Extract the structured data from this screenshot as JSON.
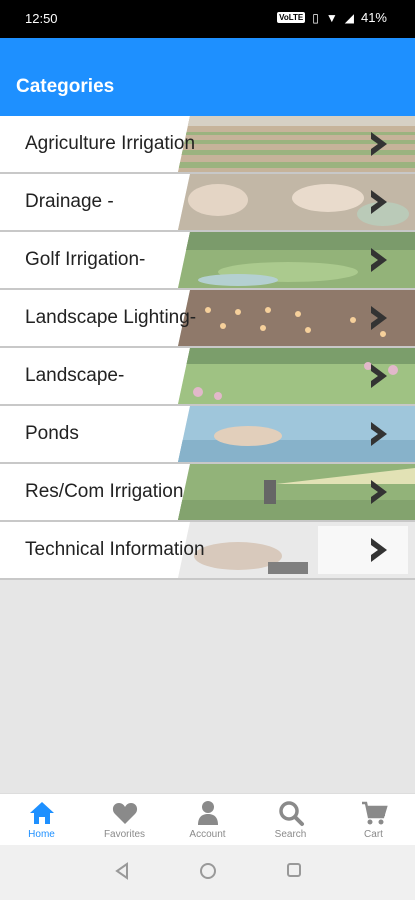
{
  "status_bar": {
    "time": "12:50",
    "volte": "VoLTE",
    "battery": "41%"
  },
  "app_bar": {
    "title": "Categories"
  },
  "categories": [
    {
      "label": "Agriculture Irrigation",
      "image": "crop-field"
    },
    {
      "label": "Drainage -",
      "image": "hands-soil"
    },
    {
      "label": "Golf Irrigation-",
      "image": "golf-course-sprinkler"
    },
    {
      "label": "Landscape Lighting-",
      "image": "lit-patio"
    },
    {
      "label": "Landscape-",
      "image": "garden-lawn"
    },
    {
      "label": "Ponds",
      "image": "hands-water"
    },
    {
      "label": "Res/Com Irrigation",
      "image": "sprinkler-head"
    },
    {
      "label": "Technical Information",
      "image": "hands-paperwork"
    }
  ],
  "bottom_nav": [
    {
      "label": "Home",
      "icon": "home-icon",
      "active": true
    },
    {
      "label": "Favorites",
      "icon": "heart-icon",
      "active": false
    },
    {
      "label": "Account",
      "icon": "person-icon",
      "active": false
    },
    {
      "label": "Search",
      "icon": "search-icon",
      "active": false
    },
    {
      "label": "Cart",
      "icon": "cart-icon",
      "active": false
    }
  ],
  "colors": {
    "accent": "#1e90ff",
    "inactive_nav": "#8a8a8a",
    "background": "#e6e6e6"
  }
}
